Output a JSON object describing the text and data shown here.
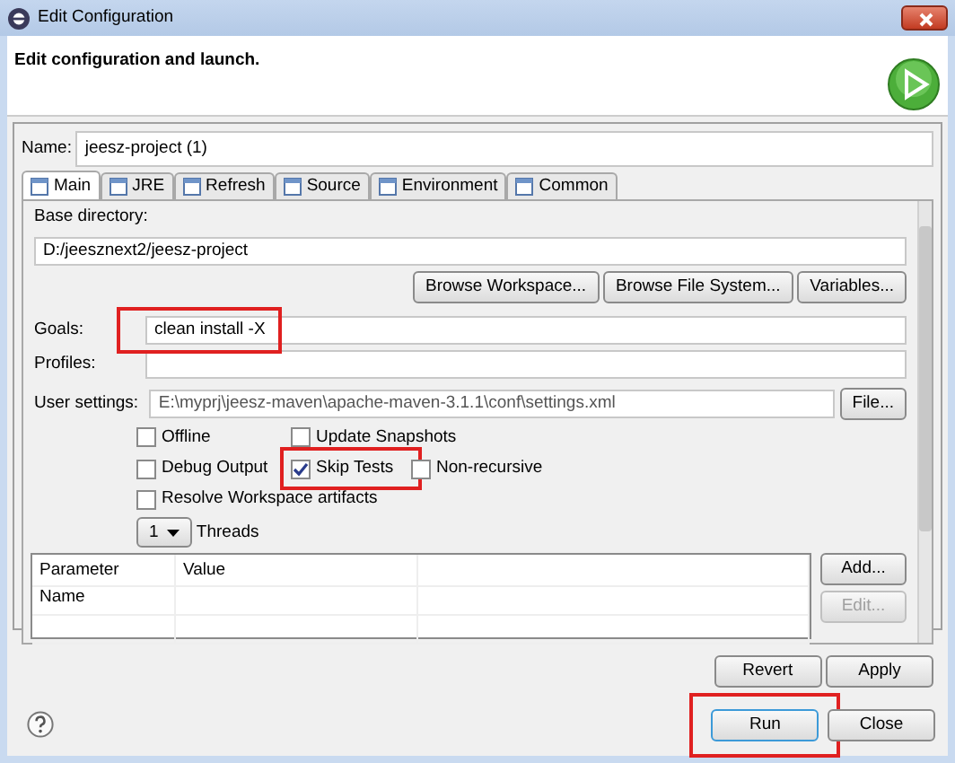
{
  "window": {
    "title": "Edit Configuration"
  },
  "header": {
    "title": "Edit configuration and launch."
  },
  "name": {
    "label": "Name:",
    "value": "jeesz-project (1)"
  },
  "tabs": [
    {
      "label": "Main",
      "selected": true
    },
    {
      "label": "JRE",
      "selected": false
    },
    {
      "label": "Refresh",
      "selected": false
    },
    {
      "label": "Source",
      "selected": false
    },
    {
      "label": "Environment",
      "selected": false
    },
    {
      "label": "Common",
      "selected": false
    }
  ],
  "base_directory": {
    "label": "Base directory:",
    "value": "D:/jeesznext2/jeesz-project"
  },
  "browse_buttons": [
    {
      "label": "Browse Workspace..."
    },
    {
      "label": "Browse File System..."
    },
    {
      "label": "Variables..."
    }
  ],
  "goals": {
    "label": "Goals:",
    "value": "clean install -X",
    "highlighted": true
  },
  "profiles": {
    "label": "Profiles:"
  },
  "user_settings": {
    "label": "User settings:",
    "value": "E:\\myprj\\jeesz-maven\\apache-maven-3.1.1\\conf\\settings.xml",
    "button": "File..."
  },
  "option_rows": [
    [
      {
        "label": "Offline",
        "checked": false,
        "highlighted": false
      },
      {
        "label": "Update Snapshots",
        "checked": false,
        "highlighted": false
      }
    ],
    [
      {
        "label": "Debug Output",
        "checked": false,
        "highlighted": false
      },
      {
        "label": "Skip Tests",
        "checked": true,
        "highlighted": true
      },
      {
        "label": "Non-recursive",
        "checked": false,
        "highlighted": false
      }
    ],
    [
      {
        "label": "Resolve Workspace artifacts",
        "checked": false,
        "highlighted": false
      }
    ]
  ],
  "threads": {
    "value": "1",
    "label": "Threads"
  },
  "parameters": {
    "columns": [
      "Parameter Name",
      "Value"
    ],
    "buttons": [
      {
        "label": "Add...",
        "disabled": false
      },
      {
        "label": "Edit...",
        "disabled": true
      }
    ]
  },
  "actions": [
    {
      "label": "Revert"
    },
    {
      "label": "Apply"
    }
  ],
  "footer_buttons": [
    {
      "label": "Run",
      "highlighted": true
    },
    {
      "label": "Close",
      "highlighted": false
    }
  ]
}
